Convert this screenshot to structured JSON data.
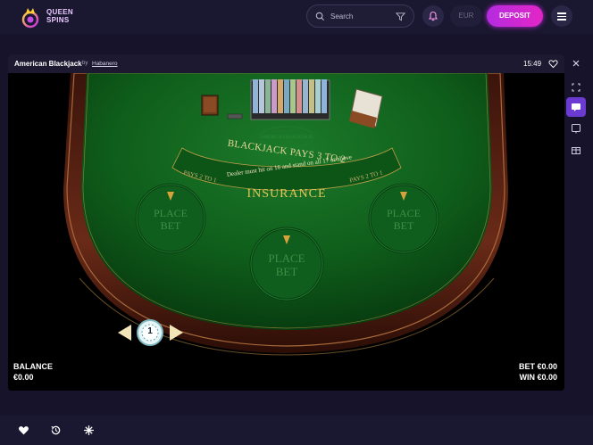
{
  "header": {
    "logo_line1": "QUEEN",
    "logo_line2": "SPINS",
    "search_placeholder": "Search",
    "currency": "EUR",
    "deposit_label": "DEPOSIT"
  },
  "game": {
    "title": "American Blackjack",
    "by_label": "by",
    "provider": "Habanero",
    "time": "15:49",
    "table_text": {
      "blackjack_pays": "BLACKJACK PAYS 3 TO 2",
      "dealer_rule": "Dealer must hit on 16 and stand on all 17 or above",
      "insurance": "INSURANCE",
      "insurance_pays_left": "PAYS 2 TO 1",
      "insurance_pays_right": "PAYS 2 TO 1",
      "logo": "AMERICAN BLACKJACK",
      "place_bet": "PLACE BET",
      "place_bet_line1": "PLACE",
      "place_bet_line2": "BET",
      "chip_value": "1"
    },
    "balance_label": "BALANCE",
    "balance_value": "€0.00",
    "bet_label": "BET",
    "bet_value": "€0.00",
    "win_label": "WIN",
    "win_value": "€0.00"
  },
  "rail": {
    "icons": [
      "fullscreen-icon",
      "chat-icon",
      "info-icon",
      "gift-icon"
    ]
  },
  "bottom": {
    "icons": [
      "heart-icon",
      "history-icon",
      "sparkle-icon"
    ]
  },
  "colors": {
    "accent": "#d42bd0",
    "felt": "#0f5e1b",
    "rail_wood": "#5a2316",
    "background": "#16132a"
  }
}
